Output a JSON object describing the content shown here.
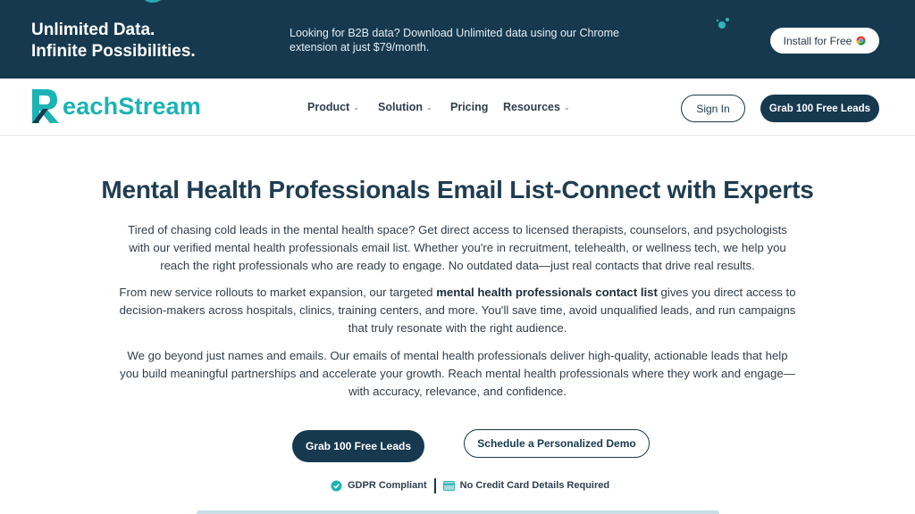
{
  "banner": {
    "title_line1": "Unlimited Data.",
    "title_line2": "Infinite Possibilities.",
    "text": "Looking for B2B data? Download Unlimited data using our Chrome extension at just $79/month.",
    "install_label": "Install for Free",
    "install_icon": "chrome-icon",
    "background_color": "#16394f"
  },
  "nav": {
    "logo_text": "eachStream",
    "logo_mark": "R",
    "items": [
      {
        "label": "Product",
        "has_dropdown": true
      },
      {
        "label": "Solution",
        "has_dropdown": true
      },
      {
        "label": "Pricing",
        "has_dropdown": false
      },
      {
        "label": "Resources",
        "has_dropdown": true
      }
    ],
    "signin_label": "Sign In",
    "grab_label": "Grab 100 Free Leads"
  },
  "hero": {
    "title": "Mental Health Professionals Email List-Connect with Experts",
    "paragraph1": "Tired of chasing cold leads in the mental health space? Get direct access to licensed therapists, counselors, and psychologists with our verified mental health professionals email list. Whether you're in recruitment, telehealth, or wellness tech, we help you reach the right professionals who are ready to engage. No outdated data—just real contacts that drive real results.",
    "paragraph2_before": "From new service rollouts to market expansion, our targeted ",
    "paragraph2_bold": "mental health professionals contact list",
    "paragraph2_after": " gives you direct access to decision-makers across hospitals, clinics, training centers, and more. You'll save time, avoid unqualified leads, and run campaigns that truly resonate with the right audience.",
    "paragraph3": "We go beyond just names and emails. Our emails of mental health professionals deliver high-quality, actionable leads that help you build meaningful partnerships and accelerate your growth. Reach mental health professionals where they work and engage—with accuracy, relevance, and confidence.",
    "cta_primary": "Grab 100 Free Leads",
    "cta_secondary": "Schedule a Personalized Demo",
    "badge1": "GDPR Compliant",
    "badge2": "No Credit Card Details Required"
  },
  "colors": {
    "brand_dark": "#16394f",
    "brand_teal": "#1bb3b3"
  }
}
